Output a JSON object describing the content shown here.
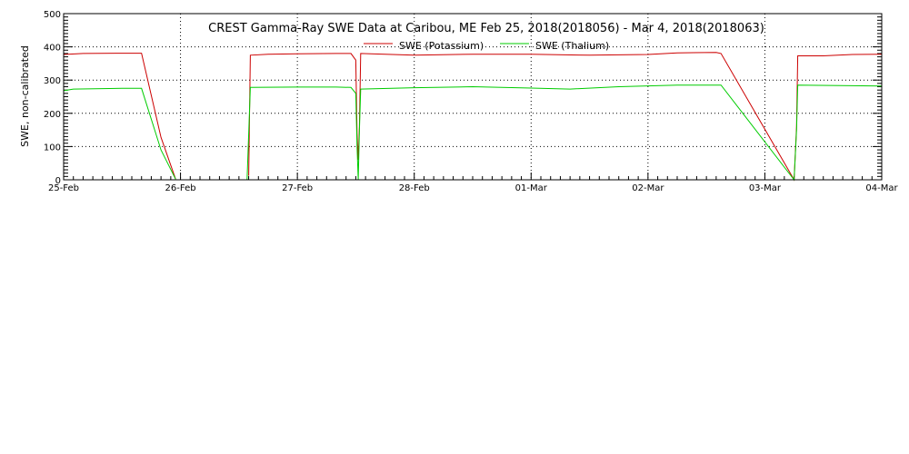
{
  "chart_data": {
    "type": "line",
    "title": "CREST Gamma-Ray SWE Data at Caribou, ME   Feb 25, 2018(2018056) - Mar  4, 2018(2018063)",
    "xlabel": "",
    "ylabel": "SWE, non-calibrated",
    "ylim": [
      0,
      500
    ],
    "yticks": [
      0,
      100,
      200,
      300,
      400,
      500
    ],
    "xlim": [
      "2018-02-25",
      "2018-03-04"
    ],
    "xticks": [
      "25-Feb",
      "26-Feb",
      "27-Feb",
      "28-Feb",
      "01-Mar",
      "02-Mar",
      "03-Mar",
      "04-Mar"
    ],
    "grid": true,
    "legend": "top-center",
    "series": [
      {
        "name": "SWE (Potassium)",
        "color": "#cc0000",
        "points": [
          [
            "2018-02-25 00:00",
            377
          ],
          [
            "2018-02-25 04:00",
            380
          ],
          [
            "2018-02-25 12:00",
            381
          ],
          [
            "2018-02-25 16:00",
            381
          ],
          [
            "2018-02-25 20:00",
            128
          ],
          [
            "2018-02-25 23:00",
            2
          ],
          [
            null,
            null
          ],
          [
            "2018-02-26 14:00",
            12
          ],
          [
            "2018-02-26 14:20",
            375
          ],
          [
            "2018-02-26 18:00",
            378
          ],
          [
            "2018-02-27 00:00",
            379
          ],
          [
            "2018-02-27 08:00",
            380
          ],
          [
            "2018-02-27 11:00",
            380
          ],
          [
            "2018-02-27 12:00",
            360
          ],
          [
            "2018-02-27 12:15",
            140
          ],
          [
            "2018-02-27 12:30",
            60
          ],
          [
            "2018-02-27 12:45",
            160
          ],
          [
            "2018-02-27 13:00",
            380
          ],
          [
            "2018-02-27 18:00",
            378
          ],
          [
            "2018-02-28 00:00",
            375
          ],
          [
            "2018-02-28 12:00",
            378
          ],
          [
            "2018-03-01 00:00",
            378
          ],
          [
            "2018-03-01 12:00",
            375
          ],
          [
            "2018-03-02 00:00",
            377
          ],
          [
            "2018-03-02 06:00",
            382
          ],
          [
            "2018-03-02 14:00",
            383
          ],
          [
            "2018-03-02 15:00",
            380
          ],
          [
            "2018-03-03 06:00",
            0
          ],
          [
            "2018-03-03 06:30",
            160
          ],
          [
            "2018-03-03 06:45",
            373
          ],
          [
            "2018-03-03 12:00",
            373
          ],
          [
            "2018-03-03 18:00",
            377
          ],
          [
            "2018-03-04 00:00",
            378
          ]
        ]
      },
      {
        "name": "SWE (Thalium)",
        "color": "#00cc00",
        "points": [
          [
            "2018-02-25 00:00",
            268
          ],
          [
            "2018-02-25 02:00",
            273
          ],
          [
            "2018-02-25 12:00",
            275
          ],
          [
            "2018-02-25 16:00",
            275
          ],
          [
            "2018-02-25 20:00",
            90
          ],
          [
            "2018-02-25 23:00",
            2
          ],
          [
            null,
            null
          ],
          [
            "2018-02-26 13:40",
            0
          ],
          [
            "2018-02-26 14:20",
            278
          ],
          [
            "2018-02-27 00:00",
            279
          ],
          [
            "2018-02-27 08:00",
            279
          ],
          [
            "2018-02-27 11:00",
            278
          ],
          [
            "2018-02-27 12:00",
            260
          ],
          [
            "2018-02-27 12:15",
            100
          ],
          [
            "2018-02-27 12:30",
            0
          ],
          [
            "2018-02-27 12:45",
            150
          ],
          [
            "2018-02-27 13:00",
            273
          ],
          [
            "2018-02-28 00:00",
            277
          ],
          [
            "2018-02-28 12:00",
            280
          ],
          [
            "2018-03-01 00:00",
            276
          ],
          [
            "2018-03-01 08:00",
            273
          ],
          [
            "2018-03-01 18:00",
            280
          ],
          [
            "2018-03-02 06:00",
            285
          ],
          [
            "2018-03-02 15:00",
            285
          ],
          [
            "2018-03-03 06:00",
            0
          ],
          [
            "2018-03-03 06:30",
            150
          ],
          [
            "2018-03-03 06:45",
            285
          ],
          [
            "2018-03-03 18:00",
            283
          ],
          [
            "2018-03-04 00:00",
            282
          ]
        ]
      }
    ]
  }
}
